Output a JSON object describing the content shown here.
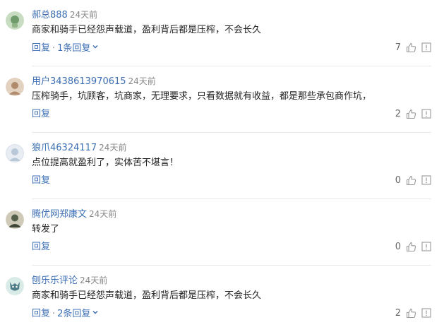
{
  "comments": [
    {
      "username": "郝总888",
      "time": "24天前",
      "text": "商家和骑手已经怨声载道，盈利背后都是压榨，不会长久",
      "reply_label": "回复",
      "reply_sep": "·",
      "replies_label": "1条回复",
      "likes": "7",
      "avatar_colors": [
        "#c7dcc0",
        "#6f9a6a"
      ]
    },
    {
      "username": "用户3438613970615",
      "time": "24天前",
      "text": "压榨骑手，坑顾客，坑商家，无理要求，只看数据就有收益，都是那些承包商作坑，",
      "reply_label": "回复",
      "likes": "2",
      "avatar_colors": [
        "#e4d2c0",
        "#b08a6c"
      ]
    },
    {
      "username": "狼爪46324117",
      "time": "24天前",
      "text": "点位提高就盈利了，实体苦不堪言！",
      "reply_label": "回复",
      "likes": "0",
      "avatar_colors": [
        "#e8edf3",
        "#b9c8d8"
      ]
    },
    {
      "username": "腾优网郑康文",
      "time": "24天前",
      "text": "转发了",
      "reply_label": "回复",
      "likes": "0",
      "avatar_colors": [
        "#cfcab8",
        "#55604a"
      ]
    },
    {
      "username": "刨乐乐评论",
      "time": "24天前",
      "text": "商家和骑手已经怨声载道，盈利背后都是压榨，不会长久",
      "reply_label": "回复",
      "reply_sep": "·",
      "replies_label": "2条回复",
      "likes": "2",
      "avatar_colors": [
        "#d9ebe6",
        "#4d7b86"
      ]
    }
  ],
  "icons": {
    "like": "thumbs-up-icon",
    "report": "report-icon",
    "expand": "chevron-down-icon"
  },
  "colors": {
    "link": "#3d6fb4",
    "muted": "#888888",
    "text": "#222222"
  }
}
